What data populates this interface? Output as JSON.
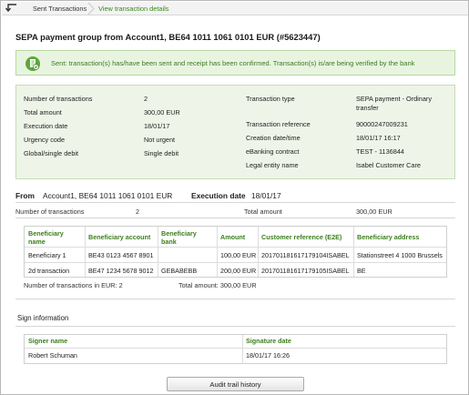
{
  "breadcrumb": {
    "items": [
      "Sent Transactions",
      "View transaction details"
    ]
  },
  "page_title": "SEPA payment group from Account1, BE64 1011 1061 0101 EUR (#5623447)",
  "message": {
    "text": "Sent: transaction(s) has/have been sent and receipt has been confirmed. Transaction(s) is/are being verified by the bank"
  },
  "info_left": [
    {
      "label": "Number of transactions",
      "value": "2"
    },
    {
      "label": "Total amount",
      "value": "300,00 EUR"
    },
    {
      "label": "Execution date",
      "value": "18/01/17"
    },
    {
      "label": "Urgency code",
      "value": "Not urgent"
    },
    {
      "label": "Global/single debit",
      "value": "Single debit"
    }
  ],
  "info_right": [
    {
      "label": "Transaction type",
      "value": "SEPA payment - Ordinary",
      "value2": "transfer"
    },
    {
      "label": "Transaction reference",
      "value": "90000247009231"
    },
    {
      "label": "Creation date/time",
      "value": "18/01/17 16:17"
    },
    {
      "label": "eBanking contract",
      "value": "TEST - 1136844"
    },
    {
      "label": "Legal entity name",
      "value": "Isabel Customer Care"
    }
  ],
  "from_line": {
    "from_label": "From",
    "from_value": "Account1, BE64 1011 1061 0101 EUR",
    "exec_label": "Execution date",
    "exec_value": "18/01/17"
  },
  "summary": {
    "count_label": "Number of transactions",
    "count_value": "2",
    "total_label": "Total amount",
    "total_value": "300,00 EUR"
  },
  "beneficiaries": {
    "headers": [
      "Beneficiary name",
      "Beneficiary account",
      "Beneficiary bank",
      "Amount",
      "Customer reference (E2E)",
      "Beneficiary address"
    ],
    "rows": [
      [
        "Beneficiary 1",
        "BE43 0123 4567 8901",
        "",
        "100,00 EUR",
        "20170118161717910​4ISABEL",
        "Stationstreet 4 1000 Brussels"
      ],
      [
        "2d transaction",
        "BE47 1234 5678 9012",
        "GEBABEBB",
        "200,00 EUR",
        "20170118161717910​5ISABEL",
        "BE"
      ]
    ],
    "footer_count": "Number of transactions in EUR: 2",
    "footer_total": "Total amount: 300,00 EUR"
  },
  "sign_info": {
    "title": "Sign information",
    "headers": [
      "Signer name",
      "Signature date"
    ],
    "rows": [
      [
        "Robert Schuman",
        "18/01/17 16:26"
      ]
    ]
  },
  "audit_button": "Audit trail history",
  "colors": {
    "accent_green": "#3b7f1c",
    "message_bg": "#e8f4e0",
    "info_bg": "#eef5e8"
  }
}
